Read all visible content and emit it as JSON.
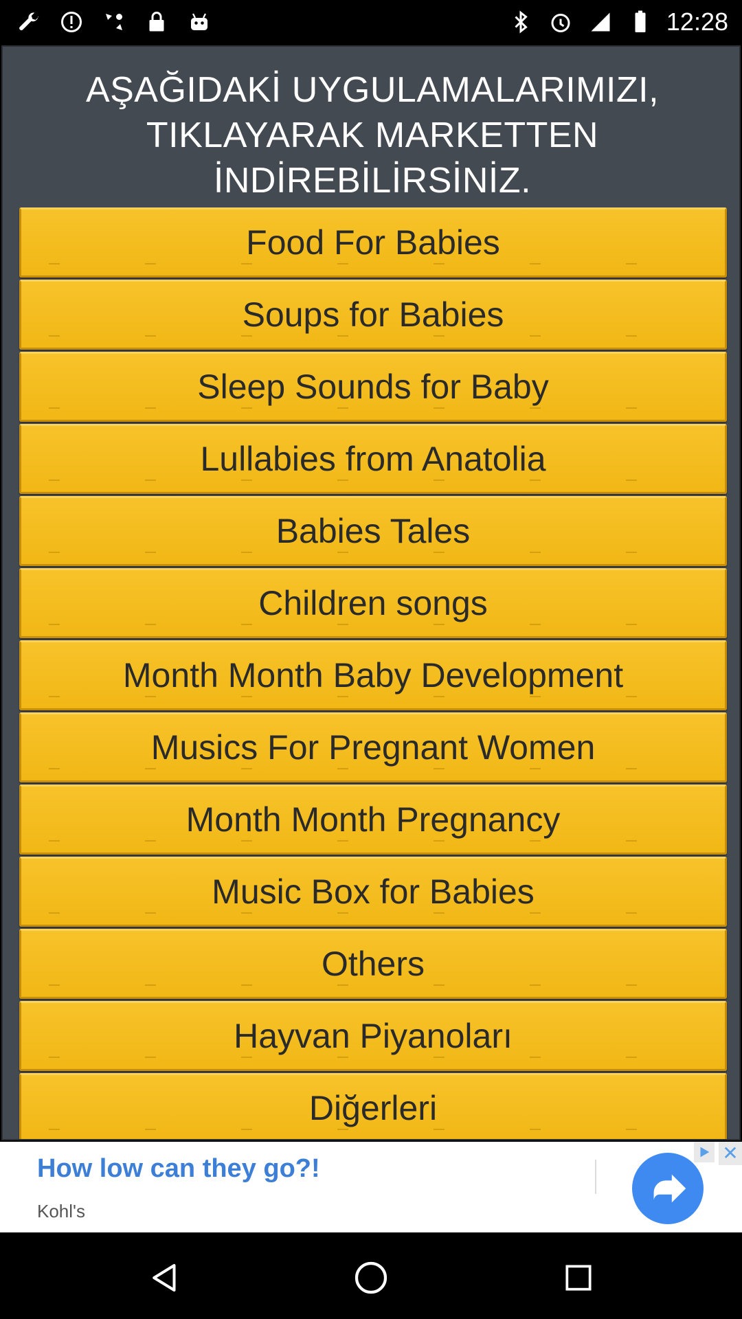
{
  "status_bar": {
    "time": "12:28",
    "left_icons": [
      "wrench-icon",
      "info-icon",
      "fake-gps-icon",
      "lock-icon",
      "android-icon"
    ],
    "right_icons": [
      "bluetooth-icon",
      "alarm-icon",
      "signal-icon",
      "battery-icon"
    ]
  },
  "header": {
    "lines": [
      "AŞAĞIDAKİ UYGULAMALARIMIZI,",
      "TIKLAYARAK MARKETTEN",
      "İNDİREBİLİRSİNİZ."
    ]
  },
  "apps": [
    {
      "label": "Food For Babies"
    },
    {
      "label": "Soups for Babies"
    },
    {
      "label": "Sleep Sounds for Baby"
    },
    {
      "label": "Lullabies from Anatolia"
    },
    {
      "label": "Babies Tales"
    },
    {
      "label": "Children songs"
    },
    {
      "label": "Month Month Baby Development"
    },
    {
      "label": "Musics For Pregnant Women"
    },
    {
      "label": "Month Month Pregnancy"
    },
    {
      "label": "Music Box for Babies"
    },
    {
      "label": "Others"
    },
    {
      "label": "Hayvan Piyanoları"
    },
    {
      "label": "Diğerleri"
    }
  ],
  "ad": {
    "headline": "How low can they go?!",
    "advertiser": "Kohl's",
    "close_symbol": "✕"
  },
  "nav": {
    "buttons": [
      "back-icon",
      "home-icon",
      "recents-icon"
    ]
  },
  "colors": {
    "panel_bg": "#444a52",
    "button_bg": "#f4bd1f",
    "ad_headline": "#3d7fd6",
    "ad_arrow": "#3f8af0"
  }
}
